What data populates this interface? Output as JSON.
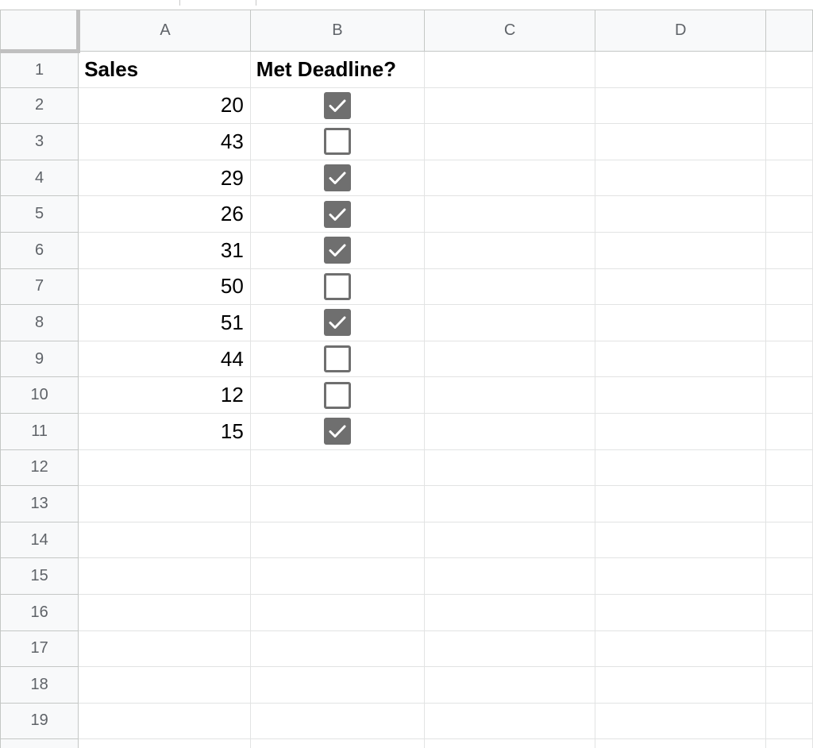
{
  "columns": [
    "A",
    "B",
    "C",
    "D",
    ""
  ],
  "rows": [
    {
      "num": "1",
      "sales": "Sales",
      "met": "Met Deadline?",
      "header": true
    },
    {
      "num": "2",
      "sales": "20",
      "checked": true
    },
    {
      "num": "3",
      "sales": "43",
      "checked": false
    },
    {
      "num": "4",
      "sales": "29",
      "checked": true
    },
    {
      "num": "5",
      "sales": "26",
      "checked": true
    },
    {
      "num": "6",
      "sales": "31",
      "checked": true
    },
    {
      "num": "7",
      "sales": "50",
      "checked": false
    },
    {
      "num": "8",
      "sales": "51",
      "checked": true
    },
    {
      "num": "9",
      "sales": "44",
      "checked": false
    },
    {
      "num": "10",
      "sales": "12",
      "checked": false
    },
    {
      "num": "11",
      "sales": "15",
      "checked": true
    },
    {
      "num": "12"
    },
    {
      "num": "13"
    },
    {
      "num": "14"
    },
    {
      "num": "15"
    },
    {
      "num": "16"
    },
    {
      "num": "17"
    },
    {
      "num": "18"
    },
    {
      "num": "19"
    },
    {
      "num": ""
    }
  ],
  "colors": {
    "checkbox": "#6f6f6f",
    "header_bg": "#f8f9fa",
    "gridline": "#e2e3e3",
    "header_text": "#5f6368"
  },
  "icons": {
    "checked": "checkbox-checked-icon",
    "unchecked": "checkbox-unchecked-icon"
  }
}
